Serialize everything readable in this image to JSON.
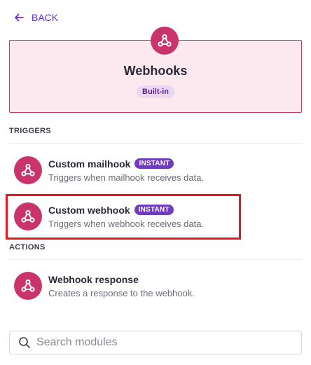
{
  "back": {
    "label": "BACK"
  },
  "app": {
    "title": "Webhooks",
    "badge": "Built-in",
    "icon": "webhook-icon"
  },
  "triggers": {
    "label": "TRIGGERS",
    "items": [
      {
        "title": "Custom mailhook",
        "badge": "INSTANT",
        "description": "Triggers when mailhook receives data.",
        "icon": "webhook-icon"
      },
      {
        "title": "Custom webhook",
        "badge": "INSTANT",
        "description": "Triggers when webhook receives data.",
        "icon": "webhook-icon"
      }
    ]
  },
  "actions": {
    "label": "ACTIONS",
    "items": [
      {
        "title": "Webhook response",
        "description": "Creates a response to the webhook.",
        "icon": "webhook-icon"
      }
    ]
  },
  "search": {
    "placeholder": "Search modules",
    "value": ""
  },
  "colors": {
    "accent": "#6d28d9",
    "brand": "#c9356b",
    "badge_bg": "#6e3cbc",
    "highlight": "#e0191f"
  }
}
